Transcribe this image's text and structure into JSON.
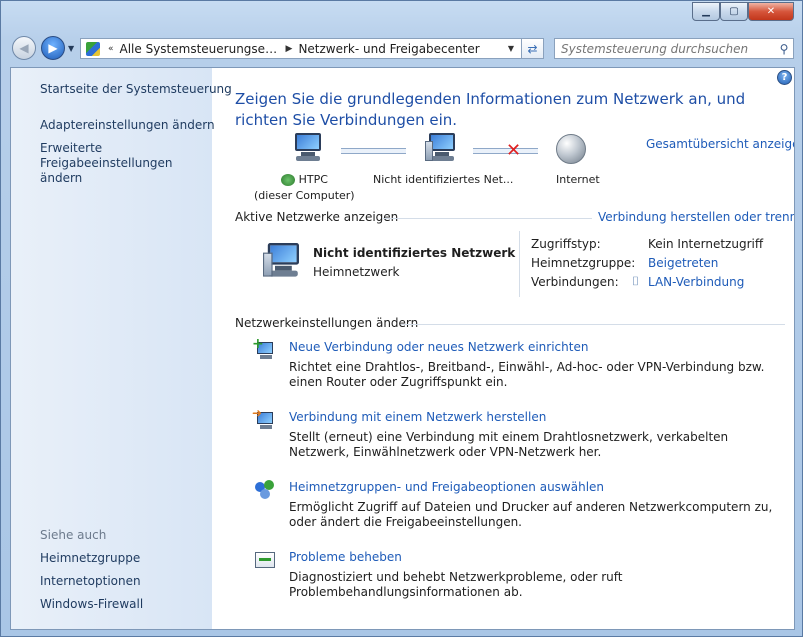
{
  "window": {
    "minimize": "▁",
    "maximize": "▢",
    "close": "✕"
  },
  "nav": {
    "back_icon": "arrow-left-icon",
    "forward_icon": "arrow-right-icon",
    "breadcrumb_overflow": "«",
    "breadcrumb": [
      "Alle Systemsteuerungselemente",
      "Netzwerk- und Freigabecenter"
    ],
    "search_placeholder": "Systemsteuerung durchsuchen"
  },
  "sidebar": {
    "links_top": [
      "Startseite der Systemsteuerung",
      "Adaptereinstellungen ändern",
      "Erweiterte Freigabeeinstellungen ändern"
    ],
    "see_also_header": "Siehe auch",
    "see_also": [
      "Heimnetzgruppe",
      "Internetoptionen",
      "Windows-Firewall"
    ]
  },
  "main": {
    "title": "Zeigen Sie die grundlegenden Informationen zum Netzwerk an, und richten Sie Verbindungen ein.",
    "full_map_link": "Gesamtübersicht anzeigen",
    "map": {
      "computer_name": "HTPC",
      "computer_sub": "(dieser Computer)",
      "network_name": "Nicht identifiziertes Net...",
      "internet": "Internet"
    },
    "active_networks_header": "Aktive Netzwerke anzeigen",
    "connect_link": "Verbindung herstellen oder trennen",
    "active_network": {
      "name": "Nicht identifiziertes Netzwerk",
      "type": "Heimnetzwerk",
      "access_type_label": "Zugriffstyp:",
      "access_type_value": "Kein Internetzugriff",
      "homegroup_label": "Heimnetzgruppe:",
      "homegroup_value": "Beigetreten",
      "connections_label": "Verbindungen:",
      "connections_value": "LAN-Verbindung"
    },
    "settings_header": "Netzwerkeinstellungen ändern",
    "tasks": [
      {
        "link": "Neue Verbindung oder neues Netzwerk einrichten",
        "desc": "Richtet eine Drahtlos-, Breitband-, Einwähl-, Ad-hoc- oder VPN-Verbindung bzw. einen Router oder Zugriffspunkt ein."
      },
      {
        "link": "Verbindung mit einem Netzwerk herstellen",
        "desc": "Stellt (erneut) eine Verbindung mit einem Drahtlosnetzwerk, verkabelten Netzwerk, Einwählnetzwerk oder VPN-Netzwerk her."
      },
      {
        "link": "Heimnetzgruppen- und Freigabeoptionen auswählen",
        "desc": "Ermöglicht Zugriff auf Dateien und Drucker auf anderen Netzwerkcomputern zu, oder ändert die Freigabeeinstellungen."
      },
      {
        "link": "Probleme beheben",
        "desc": "Diagnostiziert und behebt Netzwerkprobleme, oder ruft Problembehandlungsinformationen ab."
      }
    ]
  },
  "colors": {
    "link": "#1e5bb8",
    "title": "#1e4ea6",
    "sidebar": "#dfe9f6"
  }
}
